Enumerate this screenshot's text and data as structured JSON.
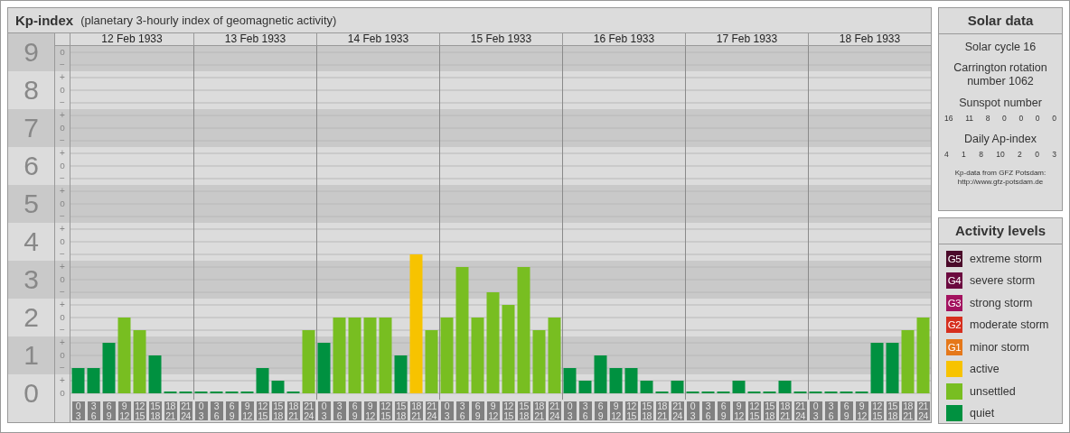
{
  "kp_panel": {
    "title": "Kp-index",
    "subtitle": "(planetary 3-hourly index of geomagnetic activity)",
    "days": [
      "12 Feb 1933",
      "13 Feb 1933",
      "14 Feb 1933",
      "15 Feb 1933",
      "16 Feb 1933",
      "17 Feb 1933",
      "18 Feb 1933"
    ],
    "minor_ticks": [
      "o",
      "−",
      "+",
      "o",
      "−",
      "+",
      "o",
      "−",
      "+",
      "o",
      "−",
      "+",
      "o",
      "−",
      "+",
      "o",
      "−",
      "+",
      "o",
      "−",
      "+",
      "o",
      "−",
      "+",
      "o",
      "−",
      "+",
      "o"
    ],
    "chart_data": {
      "type": "bar",
      "grid": true,
      "ylim": [
        0,
        9
      ],
      "yticks": [
        9,
        8,
        7,
        6,
        5,
        4,
        3,
        2,
        1,
        0
      ],
      "categories": [
        "0\n3",
        "3\n6",
        "6\n9",
        "9\n12",
        "12\n15",
        "15\n18",
        "18\n21",
        "21\n24",
        "0\n3",
        "3\n6",
        "6\n9",
        "9\n12",
        "12\n15",
        "15\n18",
        "18\n21",
        "21\n24",
        "0\n3",
        "3\n6",
        "6\n9",
        "9\n12",
        "12\n15",
        "15\n18",
        "18\n21",
        "21\n24",
        "0\n3",
        "3\n6",
        "6\n9",
        "9\n12",
        "12\n15",
        "15\n18",
        "18\n21",
        "21\n24",
        "0\n3",
        "3\n6",
        "6\n9",
        "9\n12",
        "12\n15",
        "15\n18",
        "18\n21",
        "21\n24",
        "0\n3",
        "3\n6",
        "6\n9",
        "9\n12",
        "12\n15",
        "15\n18",
        "18\n21",
        "21\n24",
        "0\n3",
        "3\n6",
        "6\n9",
        "9\n12",
        "12\n15",
        "15\n18",
        "18\n21",
        "21\n24"
      ],
      "series": [
        {
          "color": "#009140",
          "values": [
            0.67,
            0.67,
            1.33,
            null,
            null,
            1,
            0,
            0,
            0,
            0,
            0,
            0,
            0.67,
            0.33,
            0,
            null,
            1.33,
            null,
            null,
            null,
            null,
            1,
            null,
            null,
            null,
            null,
            null,
            null,
            null,
            null,
            null,
            null,
            0.67,
            0.33,
            1,
            0.67,
            0.67,
            0.33,
            0,
            0.33,
            0,
            0,
            0,
            0.33,
            0,
            0,
            0.33,
            0,
            0,
            0,
            0,
            0,
            1.33,
            1.33,
            null,
            null
          ]
        },
        {
          "color": "#78be21",
          "values": [
            null,
            null,
            null,
            2,
            1.67,
            null,
            null,
            null,
            null,
            null,
            null,
            null,
            null,
            null,
            null,
            1.67,
            null,
            2,
            2,
            2,
            2,
            null,
            null,
            1.67,
            2,
            3.33,
            2,
            2.67,
            2.33,
            3.33,
            1.67,
            2,
            null,
            null,
            null,
            null,
            null,
            null,
            null,
            null,
            null,
            null,
            null,
            null,
            null,
            null,
            null,
            null,
            null,
            null,
            null,
            null,
            null,
            null,
            1.67,
            2
          ]
        },
        {
          "color": "#f7c300",
          "values": [
            null,
            null,
            null,
            null,
            null,
            null,
            null,
            null,
            null,
            null,
            null,
            null,
            null,
            null,
            null,
            null,
            null,
            null,
            null,
            null,
            null,
            null,
            3.67,
            null,
            null,
            null,
            null,
            null,
            null,
            null,
            null,
            null,
            null,
            null,
            null,
            null,
            null,
            null,
            null,
            null,
            null,
            null,
            null,
            null,
            null,
            null,
            null,
            null,
            null,
            null,
            null,
            null,
            null,
            null,
            null,
            null
          ]
        }
      ]
    }
  },
  "solar_data": {
    "title": "Solar data",
    "cycle": "Solar cycle 16",
    "carrington": "Carrington rotation number 1062",
    "sunspot_label": "Sunspot number",
    "sunspot_values": [
      "16",
      "11",
      "8",
      "0",
      "0",
      "0",
      "0"
    ],
    "ap_label": "Daily Ap-index",
    "ap_values": [
      "4",
      "1",
      "8",
      "10",
      "2",
      "0",
      "3"
    ],
    "source": "Kp-data from GFZ Potsdam:",
    "source_url": "http://www.gfz-potsdam.de"
  },
  "activity_levels": {
    "title": "Activity levels",
    "items": [
      {
        "badge": "G5",
        "label": "extreme storm",
        "color": "#4b0a2a"
      },
      {
        "badge": "G4",
        "label": "severe storm",
        "color": "#6b0a3f"
      },
      {
        "badge": "G3",
        "label": "strong storm",
        "color": "#a3125f"
      },
      {
        "badge": "G2",
        "label": "moderate storm",
        "color": "#d62f1e"
      },
      {
        "badge": "G1",
        "label": "minor storm",
        "color": "#e5781a"
      },
      {
        "label": "active",
        "color": "#f7c300"
      },
      {
        "label": "unsettled",
        "color": "#78be21"
      },
      {
        "label": "quiet",
        "color": "#009140"
      }
    ]
  }
}
